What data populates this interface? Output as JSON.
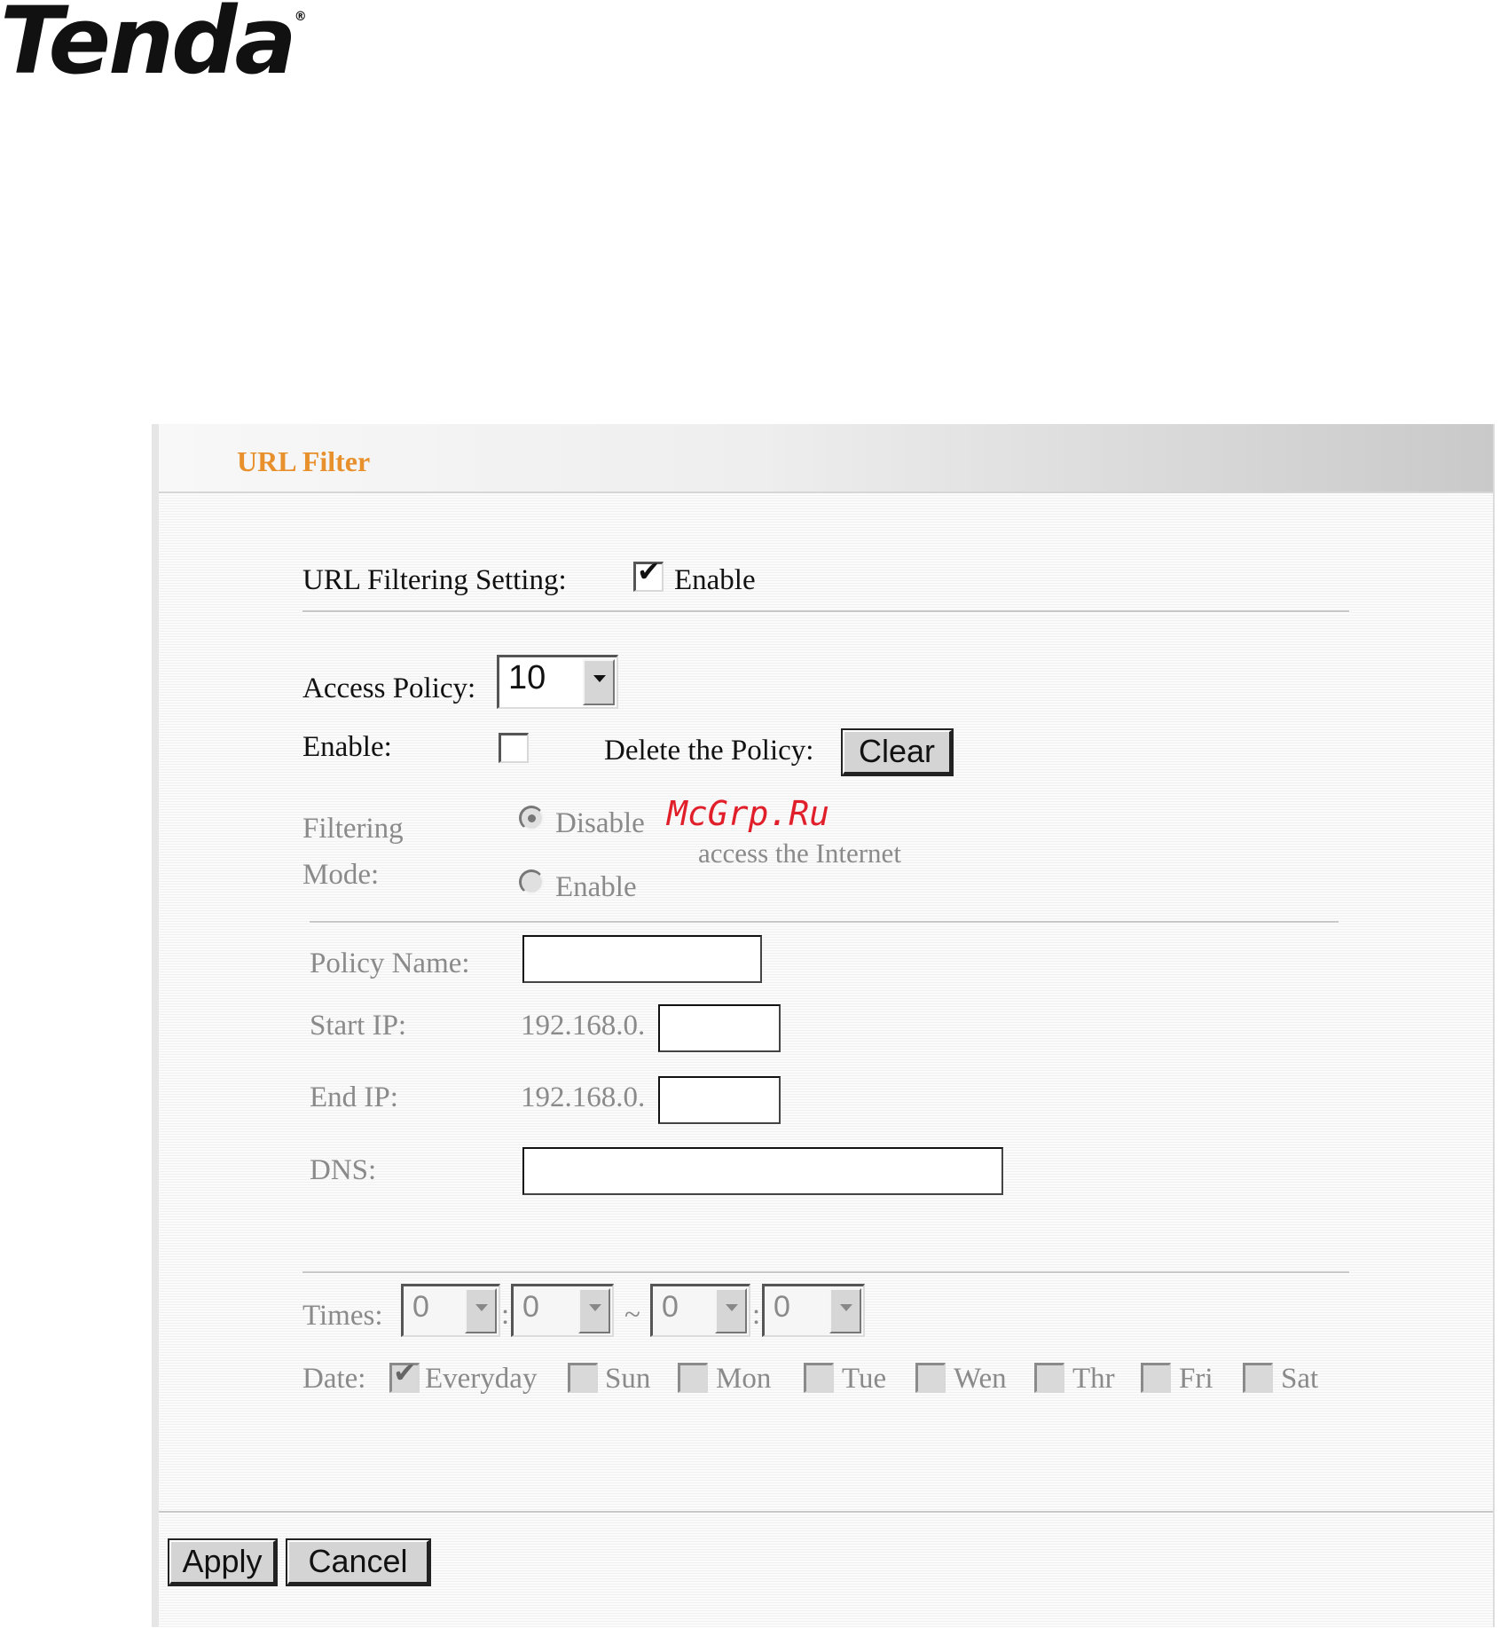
{
  "logo": {
    "text": "Tenda",
    "mark": "®"
  },
  "panel": {
    "title": "URL Filter"
  },
  "url_filtering": {
    "label": "URL Filtering Setting:",
    "enabled": true,
    "enable_label": "Enable"
  },
  "access_policy": {
    "label": "Access Policy:",
    "value": "10"
  },
  "policy_enable": {
    "label": "Enable:",
    "checked": false
  },
  "delete_policy": {
    "label": "Delete the Policy:",
    "button": "Clear"
  },
  "filtering_mode": {
    "label_line1": "Filtering",
    "label_line2": "Mode:",
    "options": [
      "Disable",
      "Enable"
    ],
    "selected": "Disable",
    "hint": "access the Internet"
  },
  "policy_name": {
    "label": "Policy Name:",
    "value": ""
  },
  "start_ip": {
    "label": "Start IP:",
    "prefix": "192.168.0.",
    "value": ""
  },
  "end_ip": {
    "label": "End IP:",
    "prefix": "192.168.0.",
    "value": ""
  },
  "dns": {
    "label": "DNS:",
    "value": ""
  },
  "times": {
    "label": "Times:",
    "start_hour": "0",
    "start_min": "0",
    "end_hour": "0",
    "end_min": "0",
    "sep_colon": ":",
    "sep_tilde": "~"
  },
  "date": {
    "label": "Date:",
    "days": [
      {
        "label": "Everyday",
        "checked": true
      },
      {
        "label": "Sun",
        "checked": false
      },
      {
        "label": "Mon",
        "checked": false
      },
      {
        "label": "Tue",
        "checked": false
      },
      {
        "label": "Wen",
        "checked": false
      },
      {
        "label": "Thr",
        "checked": false
      },
      {
        "label": "Fri",
        "checked": false
      },
      {
        "label": "Sat",
        "checked": false
      }
    ]
  },
  "actions": {
    "apply": "Apply",
    "cancel": "Cancel"
  },
  "watermark": "McGrp.Ru",
  "colors": {
    "title_accent": "#e8902c",
    "watermark": "#e11f2a"
  },
  "checkmark_glyph": "✔"
}
